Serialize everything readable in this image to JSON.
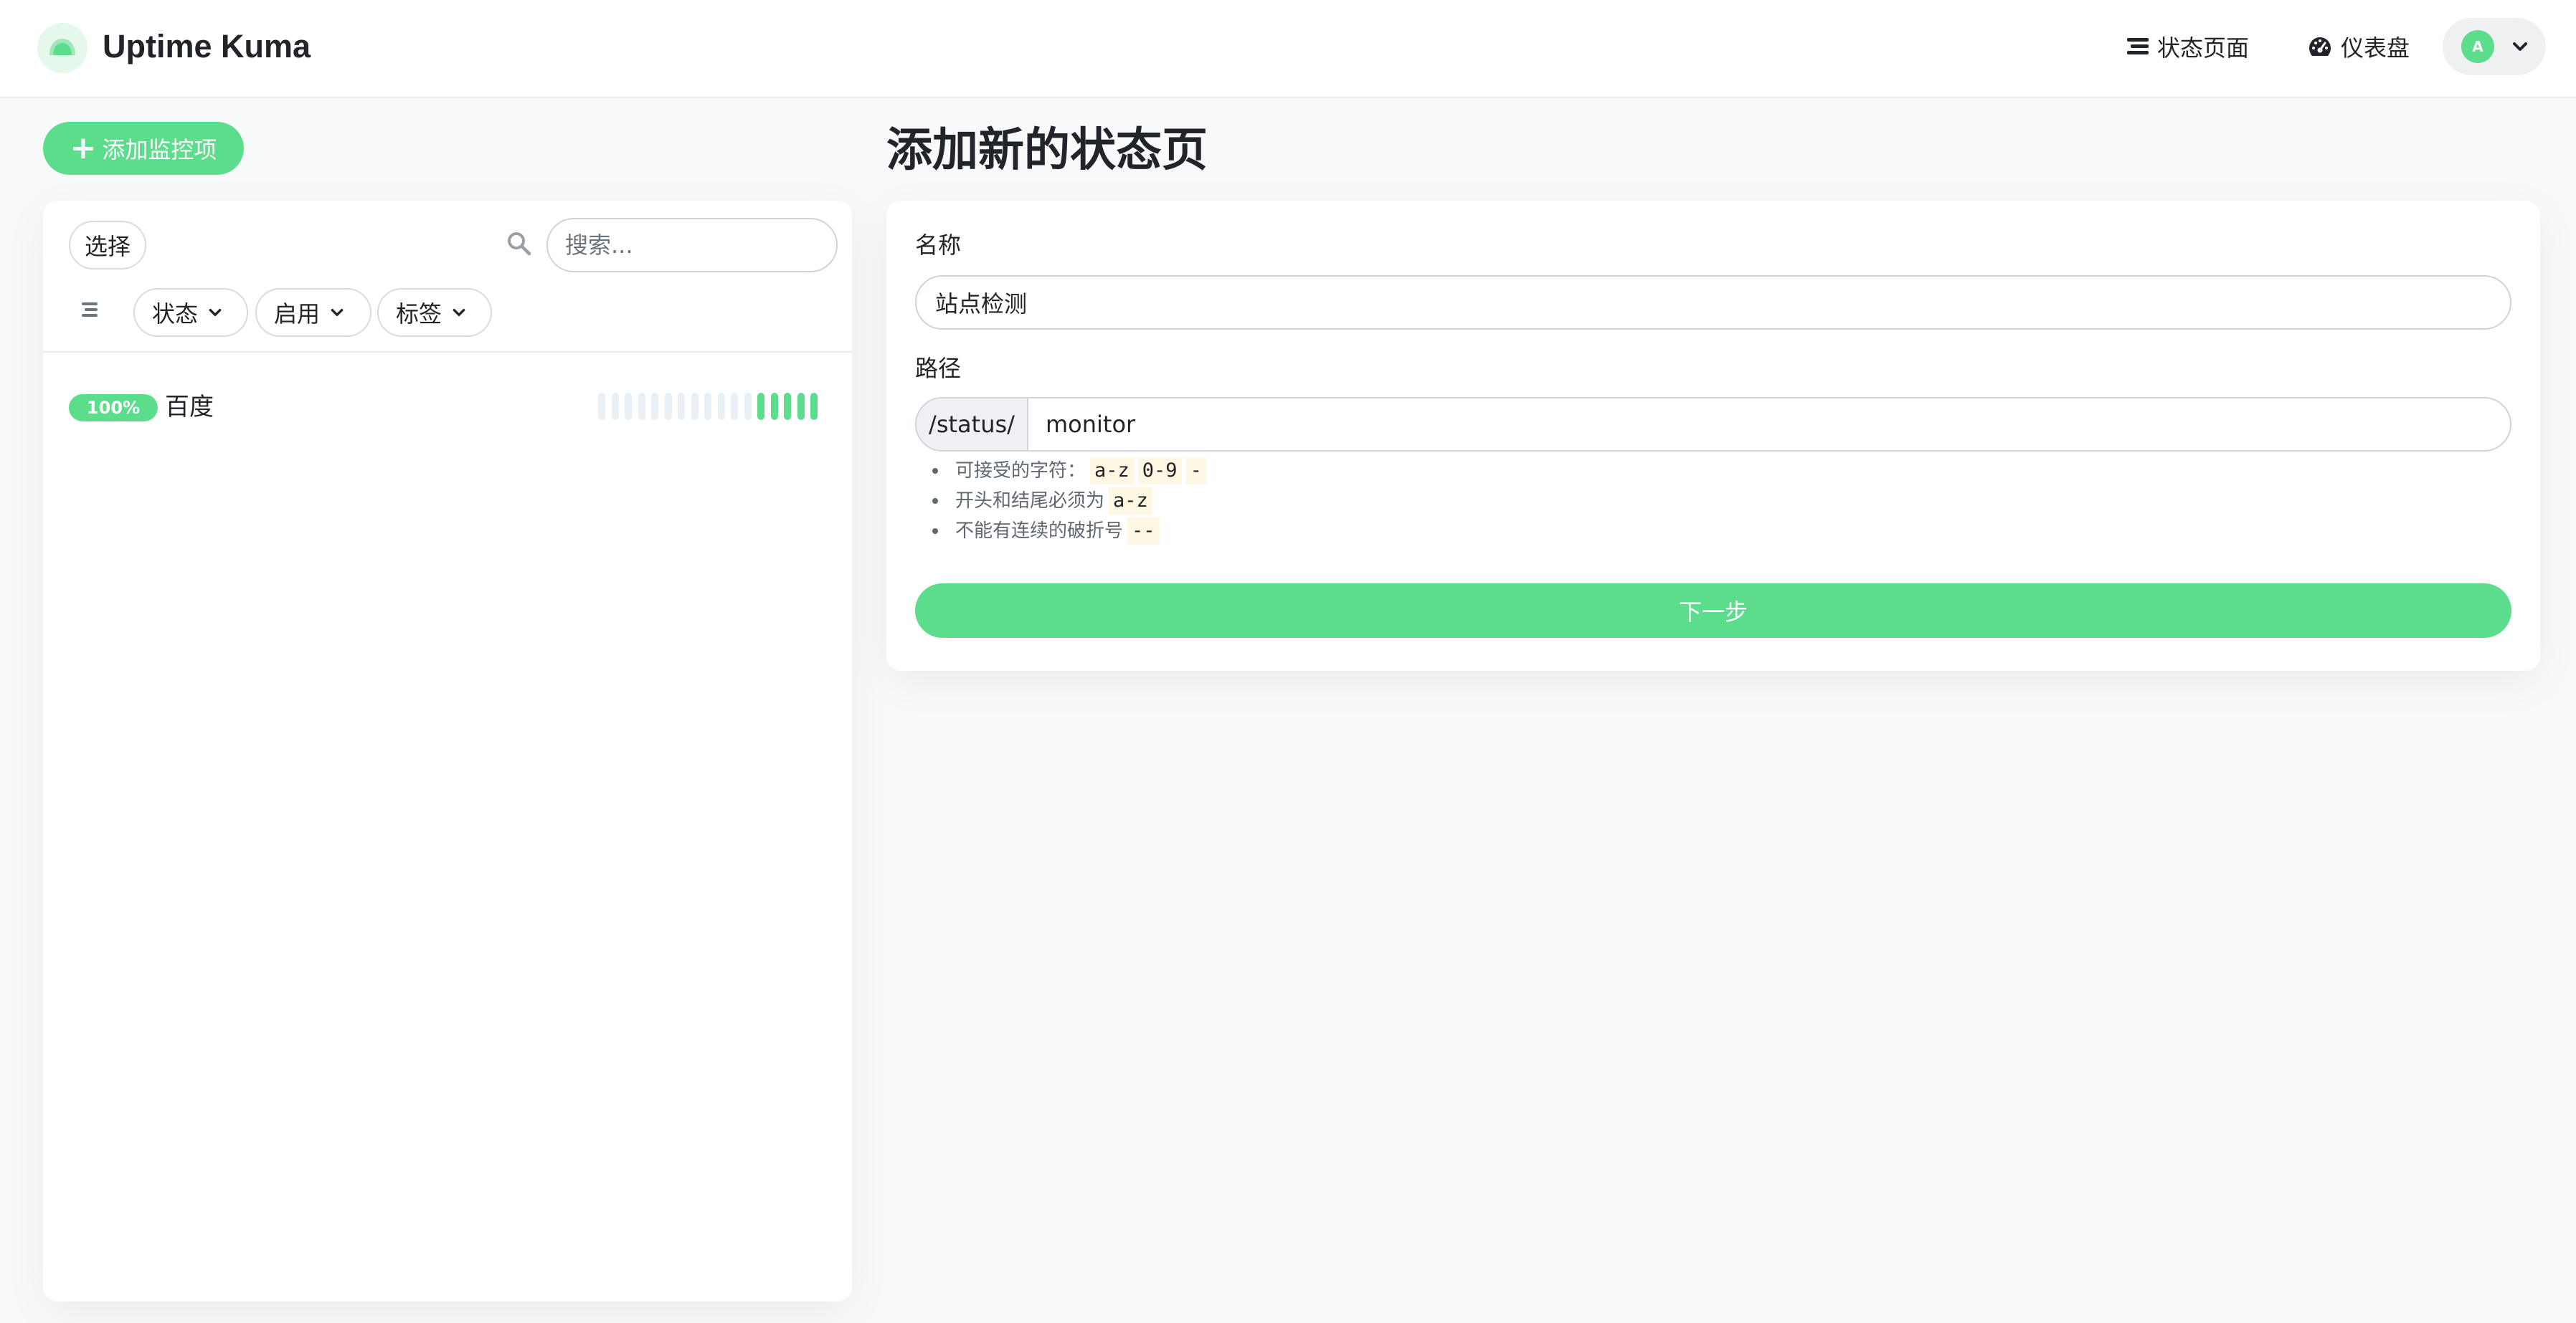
{
  "header": {
    "brand": "Uptime Kuma",
    "nav_status_pages": "状态页面",
    "nav_dashboard": "仪表盘",
    "avatar_initial": "A"
  },
  "sidebar": {
    "add_monitor_label": "添加监控项",
    "select_label": "选择",
    "search_placeholder": "搜索...",
    "filters": {
      "status": "状态",
      "active": "启用",
      "tags": "标签"
    },
    "monitors": [
      {
        "name": "百度",
        "uptime": "100%",
        "heartbeats": [
          "empty",
          "empty",
          "empty",
          "empty",
          "empty",
          "empty",
          "empty",
          "empty",
          "empty",
          "empty",
          "empty",
          "empty",
          "up",
          "up",
          "up",
          "up",
          "up"
        ]
      }
    ]
  },
  "main": {
    "title": "添加新的状态页",
    "form": {
      "name_label": "名称",
      "name_value": "站点检测",
      "path_label": "路径",
      "path_prefix": "/status/",
      "path_value": "monitor",
      "rules": [
        {
          "text": "可接受的字符：",
          "codes": [
            "a-z",
            "0-9",
            "-"
          ]
        },
        {
          "text": "开头和结尾必须为",
          "codes": [
            "a-z"
          ]
        },
        {
          "text": "不能有连续的破折号",
          "codes": [
            "--"
          ]
        }
      ],
      "next_label": "下一步"
    }
  },
  "colors": {
    "accent": "#5cdd8b",
    "beat_empty": "#e8f0f6",
    "code_bg": "#fdf7e3"
  }
}
